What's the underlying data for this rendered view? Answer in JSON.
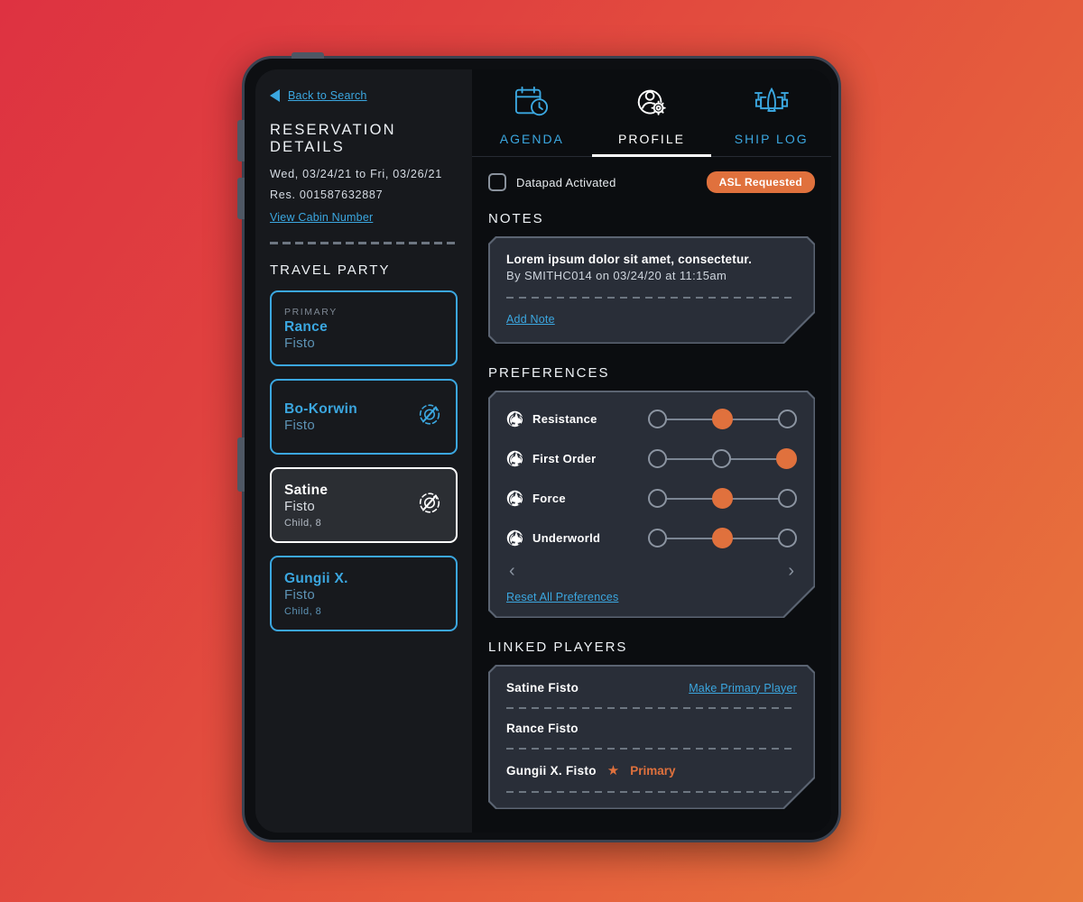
{
  "device": {
    "frame": "tablet"
  },
  "sidebar": {
    "back_link": "Back to Search",
    "section_title": "RESERVATION DETAILS",
    "dates": "Wed, 03/24/21 to Fri, 03/26/21",
    "res_number": "Res. 001587632887",
    "cabin_link": "View Cabin Number",
    "travel_party_title": "TRAVEL PARTY",
    "party": [
      {
        "tag": "PRIMARY",
        "first": "Rance",
        "last": "Fisto",
        "age": "",
        "selected": false,
        "no_droid": false
      },
      {
        "tag": "",
        "first": "Bo-Korwin",
        "last": "Fisto",
        "age": "",
        "selected": false,
        "no_droid": true
      },
      {
        "tag": "",
        "first": "Satine",
        "last": "Fisto",
        "age": "Child, 8",
        "selected": true,
        "no_droid": true
      },
      {
        "tag": "",
        "first": "Gungii X.",
        "last": "Fisto",
        "age": "Child, 8",
        "selected": false,
        "no_droid": false
      }
    ]
  },
  "tabs": [
    {
      "label": "AGENDA",
      "icon": "calendar-clock-icon",
      "active": false
    },
    {
      "label": "PROFILE",
      "icon": "person-gear-icon",
      "active": true
    },
    {
      "label": "SHIP LOG",
      "icon": "starship-icon",
      "active": false
    }
  ],
  "toolbar": {
    "datapad_label": "Datapad Activated",
    "datapad_checked": false,
    "asl_badge": "ASL Requested"
  },
  "notes": {
    "title": "NOTES",
    "body": "Lorem ipsum dolor sit amet, consectetur.",
    "meta": "By SMITHC014 on 03/24/20 at 11:15am",
    "add_link": "Add Note"
  },
  "preferences": {
    "title": "PREFERENCES",
    "reset_link": "Reset All Preferences",
    "prev_icon": "chevron-left-icon",
    "next_icon": "chevron-right-icon",
    "items": [
      {
        "label": "Resistance",
        "value": 1,
        "positions": 3
      },
      {
        "label": "First Order",
        "value": 2,
        "positions": 3
      },
      {
        "label": "Force",
        "value": 1,
        "positions": 3
      },
      {
        "label": "Underworld",
        "value": 1,
        "positions": 3
      }
    ]
  },
  "linked_players": {
    "title": "LINKED PLAYERS",
    "rows": [
      {
        "name": "Satine Fisto",
        "action": "Make Primary Player",
        "primary": false,
        "primary_label": ""
      },
      {
        "name": "Rance Fisto",
        "action": "",
        "primary": false,
        "primary_label": ""
      },
      {
        "name": "Gungii X. Fisto",
        "action": "",
        "primary": true,
        "primary_label": "Primary"
      }
    ]
  },
  "colors": {
    "accent_blue": "#3ba7e0",
    "accent_orange": "#E0713D",
    "panel_bg": "#292e38",
    "screen_bg": "#0b0d10"
  }
}
